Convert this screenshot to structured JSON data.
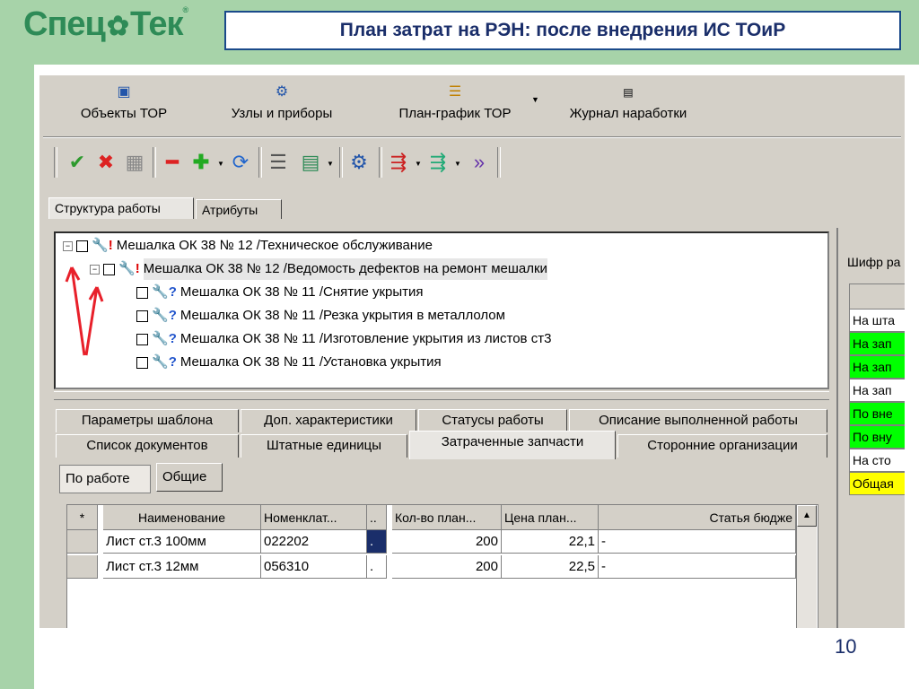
{
  "logo": {
    "part1": "Спец",
    "part2": "Тек",
    "registered": "®"
  },
  "title": "План затрат на РЭН: после внедрения ИС ТОиР",
  "page_number": "10",
  "menu": [
    {
      "label": "Объекты ТОР",
      "icon": "objects-icon"
    },
    {
      "label": "Узлы и приборы",
      "icon": "gear-icon"
    },
    {
      "label": "План-график ТОР",
      "icon": "schedule-icon"
    },
    {
      "label": "Журнал наработки",
      "icon": "counter-icon"
    }
  ],
  "toolbar": [
    "check-icon",
    "cross-icon",
    "grid-icon",
    "minus-icon",
    "plus-icon",
    "refresh-icon",
    "list-icon",
    "table-icon",
    "gear-icon",
    "tree-move-icon",
    "tree-add-icon",
    "tree-nav-icon"
  ],
  "main_tabs": [
    "Структура работы",
    "Атрибуты"
  ],
  "tree": {
    "root": "Мешалка ОК 38 № 12 /Техническое обслуживание",
    "child": "Мешалка ОК 38 № 12 /Ведомость дефектов на ремонт мешалки",
    "leaves": [
      "Мешалка ОК 38 № 11 /Снятие укрытия",
      "Мешалка ОК 38 № 11 /Резка укрытия в металлолом",
      "Мешалка ОК 38 № 11 /Изготовление укрытия из листов ст3",
      "Мешалка ОК 38 № 11 /Установка укрытия"
    ]
  },
  "sub_tabs_row1": [
    "Параметры шаблона",
    "Доп. характеристики",
    "Статусы работы",
    "Описание выполненной работы"
  ],
  "sub_tabs_row2": [
    "Список документов",
    "Штатные единицы",
    "Затраченные запчасти",
    "Сторонние организации"
  ],
  "segment": {
    "by_work": "По работе",
    "common": "Общие"
  },
  "grid": {
    "headers": [
      "*",
      "Наименование",
      "Номенклат...",
      "..",
      "Кол-во план...",
      "Цена план...",
      "Статья бюдже"
    ],
    "rows": [
      [
        "",
        "Лист ст.3 100мм",
        "022202",
        ".",
        "200",
        "22,1",
        "-"
      ],
      [
        "",
        "Лист ст.3 12мм",
        "056310",
        ".",
        "200",
        "22,5",
        "-"
      ]
    ]
  },
  "right_panel": {
    "label": "Шифр ра",
    "rows": [
      {
        "text": "На шта",
        "color": "#ffffff"
      },
      {
        "text": "На зап",
        "color": "#00ff00"
      },
      {
        "text": "На зап",
        "color": "#00ff00"
      },
      {
        "text": "На зап",
        "color": "#ffffff"
      },
      {
        "text": "По вне",
        "color": "#00ff00"
      },
      {
        "text": "По вну",
        "color": "#00ff00"
      },
      {
        "text": "На сто",
        "color": "#ffffff"
      },
      {
        "text": "Общая",
        "color": "#ffff00"
      }
    ]
  },
  "colors": {
    "background": "#a7d3a9",
    "title_border": "#1a4a8a",
    "logo": "#2e8b57",
    "arrows": "#e8202a"
  }
}
